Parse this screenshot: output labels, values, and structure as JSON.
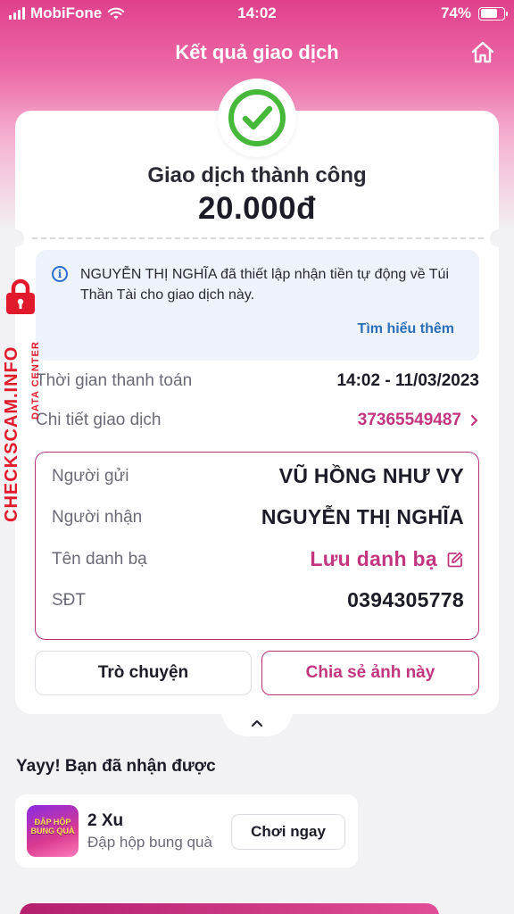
{
  "status_bar": {
    "carrier": "MobiFone",
    "time": "14:02",
    "battery": "74%",
    "battery_level": 0.74
  },
  "nav": {
    "title": "Kết quả giao dịch",
    "home_icon": "home-icon"
  },
  "result": {
    "status_icon": "check-circle-icon",
    "headline": "Giao dịch thành công",
    "amount": "20.000đ"
  },
  "info": {
    "icon": "info-icon",
    "message": "NGUYỄN THỊ NGHĨA đã thiết lập nhận tiền tự động về Túi Thần Tài cho giao dịch này.",
    "learn_more": "Tìm hiểu thêm"
  },
  "details": {
    "payment_time_label": "Thời gian thanh toán",
    "payment_time": "14:02 - 11/03/2023",
    "transaction_label": "Chi tiết giao dịch",
    "transaction_id": "37365549487"
  },
  "parties": {
    "sender_label": "Người gửi",
    "sender": "VŨ HỒNG NHƯ VY",
    "receiver_label": "Người nhận",
    "receiver": "NGUYỄN THỊ NGHĨA",
    "contact_label": "Tên danh bạ",
    "contact_action": "Lưu danh bạ",
    "phone_label": "SĐT",
    "phone": "0394305778"
  },
  "actions": {
    "chat": "Trò chuyện",
    "share": "Chia sẻ ảnh này"
  },
  "reward": {
    "title": "Yayy! Bạn đã nhận được",
    "game_logo": "ĐẬP HỘP BUNG QUÀ",
    "name": "2 Xu",
    "description": "Đập hộp bung quà",
    "play": "Chơi ngay"
  },
  "watermark": {
    "text": "CHECKSCAM.INFO",
    "sub": "DATA CENTER"
  },
  "colors": {
    "brand_pink": "#c3357f",
    "success_green": "#46b83a",
    "link_blue": "#2a6fb8",
    "watermark_red": "#e11b2c"
  }
}
